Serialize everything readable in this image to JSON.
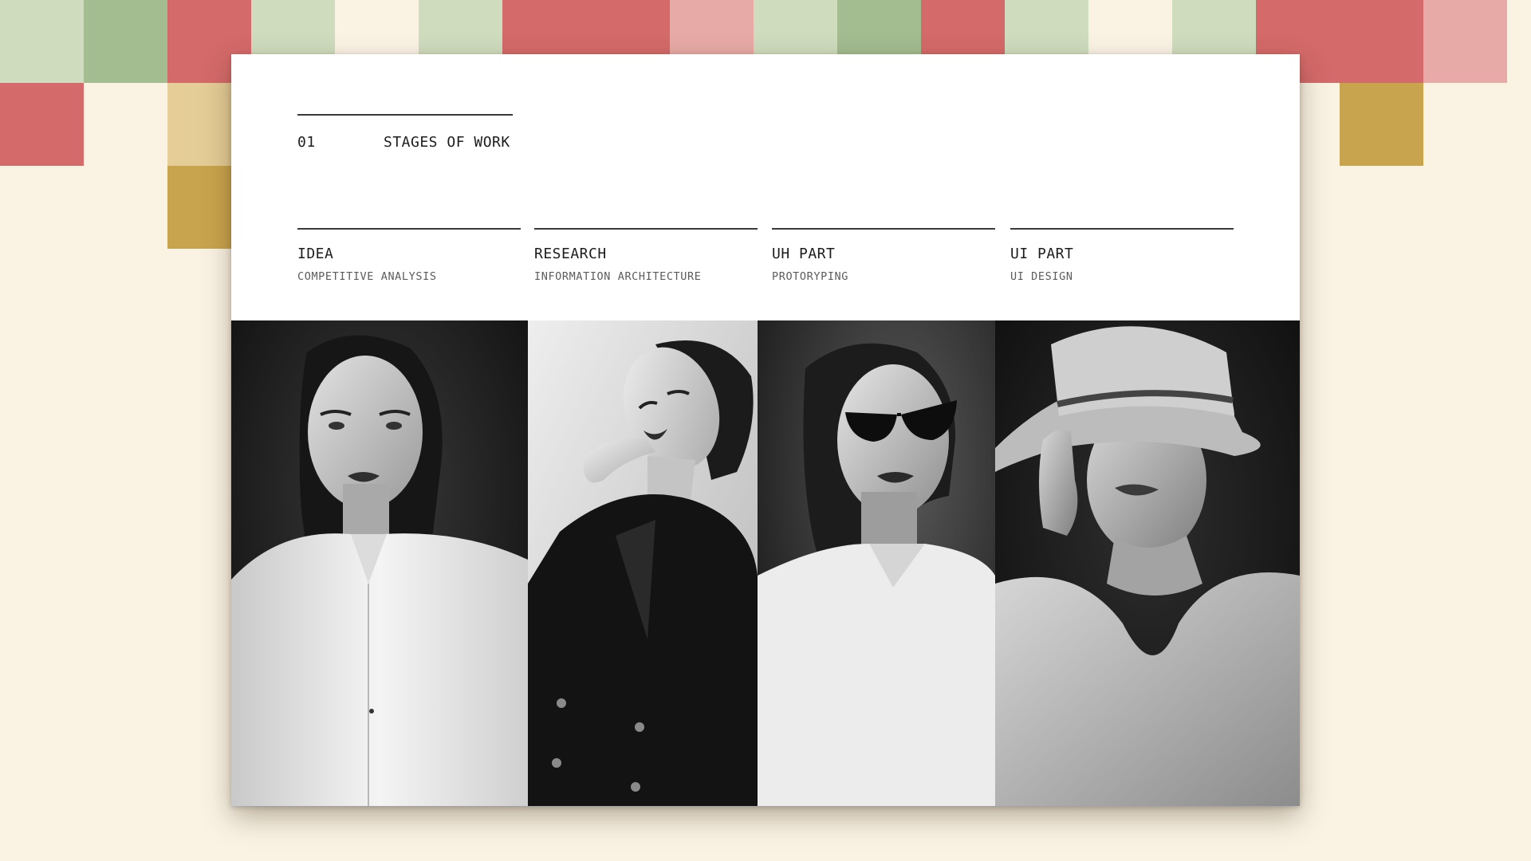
{
  "colors": {
    "background": "#faf3e4",
    "tile_red": "#d46a6a",
    "tile_pink": "#e8aaa6",
    "tile_green": "#a3bc90",
    "tile_sage": "#cfdcbe",
    "tile_gold": "#c9a44e",
    "tile_sand": "#e4cd96",
    "slide": "#ffffff",
    "ink": "#1d1d1d"
  },
  "slide": {
    "number": "01",
    "title": "STAGES OF WORK"
  },
  "stages": [
    {
      "name": "IDEA",
      "subtitle": "COMPETITIVE ANALYSIS"
    },
    {
      "name": "RESEARCH",
      "subtitle": "INFORMATION ARCHITECTURE"
    },
    {
      "name": "UH PART",
      "subtitle": "PROTORYPING"
    },
    {
      "name": "UI PART",
      "subtitle": "UI DESIGN"
    }
  ],
  "photos": [
    {
      "icon": "portrait-white-jacket"
    },
    {
      "icon": "portrait-black-blazer"
    },
    {
      "icon": "portrait-sunglasses"
    },
    {
      "icon": "portrait-hat"
    }
  ]
}
